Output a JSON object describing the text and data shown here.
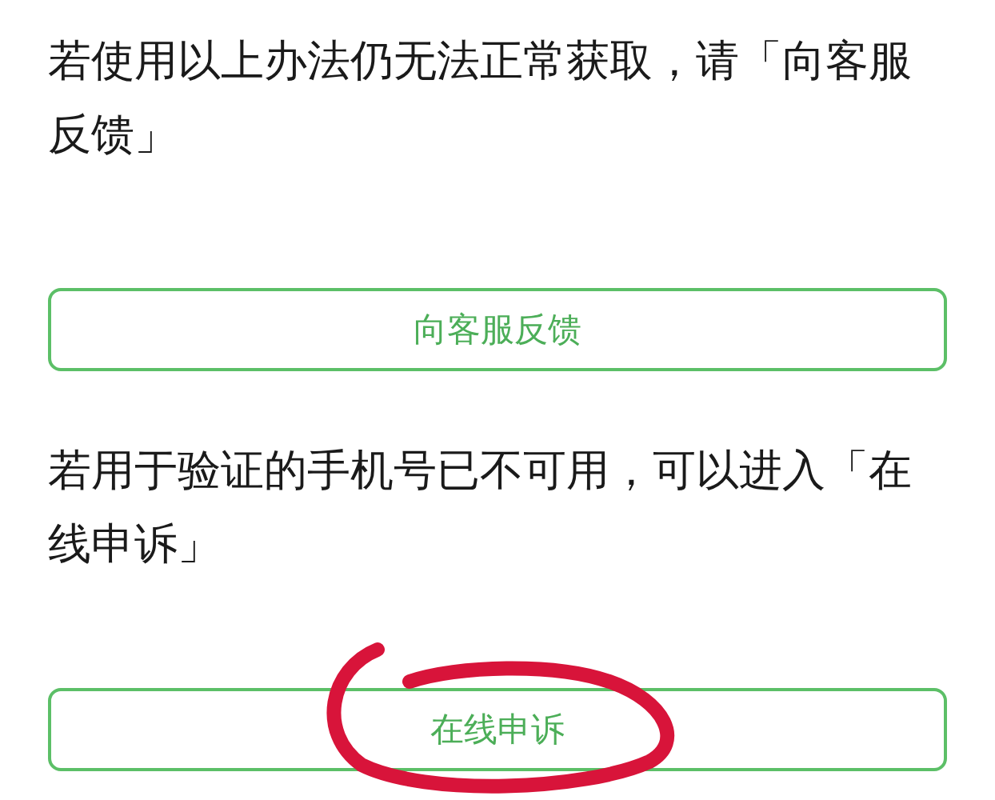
{
  "sections": [
    {
      "text": "若使用以上办法仍无法正常获取，请「向客服反馈」",
      "button": "向客服反馈"
    },
    {
      "text": "若用于验证的手机号已不可用，可以进入「在线申诉」",
      "button": "在线申诉"
    }
  ]
}
